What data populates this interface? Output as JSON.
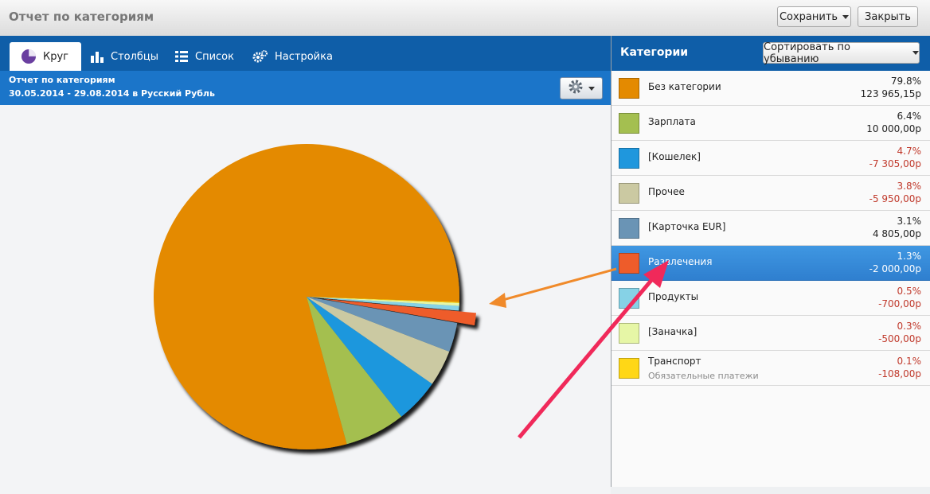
{
  "window": {
    "title": "Отчет по категориям",
    "save_label": "Сохранить",
    "close_label": "Закрыть"
  },
  "tabs": [
    {
      "label": "Круг",
      "icon": "pie-icon",
      "active": true
    },
    {
      "label": "Столбцы",
      "icon": "bars-icon"
    },
    {
      "label": "Список",
      "icon": "list-icon"
    },
    {
      "label": "Настройка",
      "icon": "settings-icon"
    }
  ],
  "report": {
    "title": "Отчет по категориям",
    "subtitle": "30.05.2014 - 29.08.2014 в Русский Рубль"
  },
  "categories_panel": {
    "title": "Категории",
    "sort_label": "Сортировать по убыванию"
  },
  "categories": [
    {
      "name": "Без категории",
      "percent": "79.8%",
      "amount": "123 965,15р",
      "color": "#e48a00",
      "negative": false
    },
    {
      "name": "Зарплата",
      "percent": "6.4%",
      "amount": "10 000,00р",
      "color": "#a4bf50",
      "negative": false
    },
    {
      "name": "[Кошелек]",
      "percent": "4.7%",
      "amount": "-7 305,00р",
      "color": "#1f97dd",
      "negative": true
    },
    {
      "name": "Прочее",
      "percent": "3.8%",
      "amount": "-5 950,00р",
      "color": "#cbc9a2",
      "negative": true
    },
    {
      "name": "[Карточка EUR]",
      "percent": "3.1%",
      "amount": "4 805,00р",
      "color": "#6a94b5",
      "negative": false
    },
    {
      "name": "Развлечения",
      "percent": "1.3%",
      "amount": "-2 000,00р",
      "color": "#ee5c2a",
      "negative": true,
      "selected": true
    },
    {
      "name": "Продукты",
      "percent": "0.5%",
      "amount": "-700,00р",
      "color": "#86d2e6",
      "negative": true
    },
    {
      "name": "[Заначка]",
      "percent": "0.3%",
      "amount": "-500,00р",
      "color": "#e6f6a6",
      "negative": true
    },
    {
      "name": "Транспорт",
      "subtitle": "Обязательные платежи",
      "percent": "0.1%",
      "amount": "-108,00р",
      "color": "#ffd716",
      "negative": true
    }
  ],
  "chart_data": {
    "type": "pie",
    "categories": [
      "Без категории",
      "Зарплата",
      "[Кошелек]",
      "Прочее",
      "[Карточка EUR]",
      "Развлечения",
      "Продукты",
      "[Заначка]",
      "Транспорт"
    ],
    "values": [
      79.8,
      6.4,
      4.7,
      3.8,
      3.1,
      1.3,
      0.5,
      0.3,
      0.1
    ],
    "colors": [
      "#e48a00",
      "#a4bf50",
      "#1f97dd",
      "#cbc9a2",
      "#6a94b5",
      "#ee5c2a",
      "#86d2e6",
      "#e6f6a6",
      "#ffd716"
    ],
    "highlighted": "Развлечения"
  }
}
